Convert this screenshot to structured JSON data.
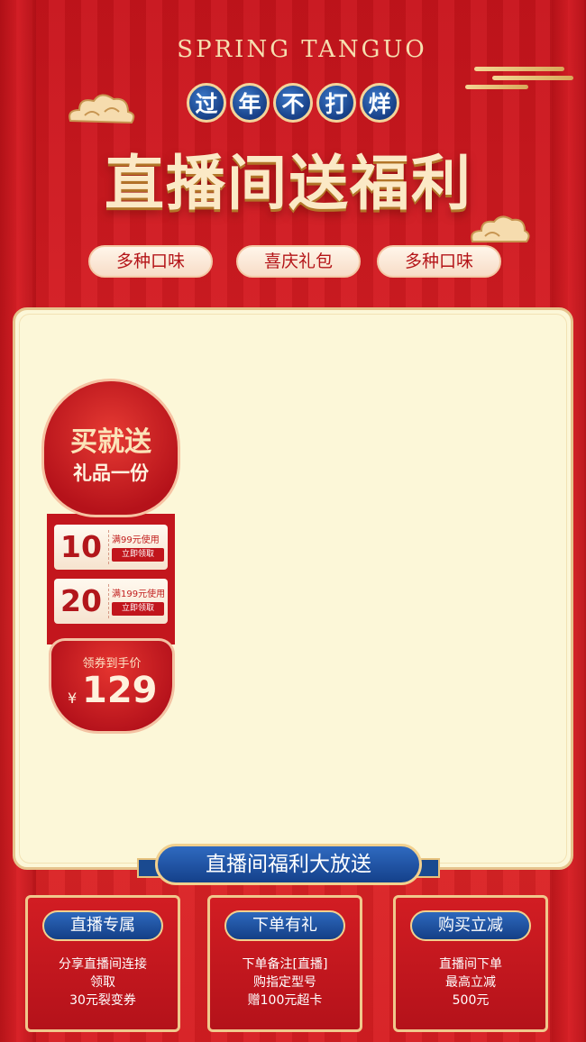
{
  "header": {
    "spring_text": "SPRING  TANGUO",
    "badges": [
      "过",
      "年",
      "不",
      "打",
      "烊"
    ],
    "main_title": "直播间送福利",
    "tags": [
      "多种口味",
      "喜庆礼包",
      "多种口味"
    ]
  },
  "promo": {
    "headline": "买就送",
    "subline": "礼品一份",
    "coupons": [
      {
        "amount": "10",
        "condition": "满99元使用",
        "action": "立即领取"
      },
      {
        "amount": "20",
        "condition": "满199元使用",
        "action": "立即领取"
      }
    ],
    "price_label": "领券到手价",
    "currency": "¥",
    "price": "129"
  },
  "banner": {
    "title": "直播间福利大放送"
  },
  "cards": [
    {
      "title": "直播专属",
      "lines": [
        "分享直播间连接",
        "领取",
        "30元裂变券"
      ]
    },
    {
      "title": "下单有礼",
      "lines": [
        "下单备注[直播]",
        "购指定型号",
        "赠100元超卡"
      ]
    },
    {
      "title": "购买立减",
      "lines": [
        "直播间下单",
        "最高立减",
        "500元"
      ]
    }
  ],
  "colors": {
    "background_red": "#d41c22",
    "gold": "#f3d49a",
    "panel_cream": "#fcf7d8",
    "blue": "#14408a"
  },
  "icons": [
    "cloud-icon",
    "gold-line-decoration"
  ]
}
